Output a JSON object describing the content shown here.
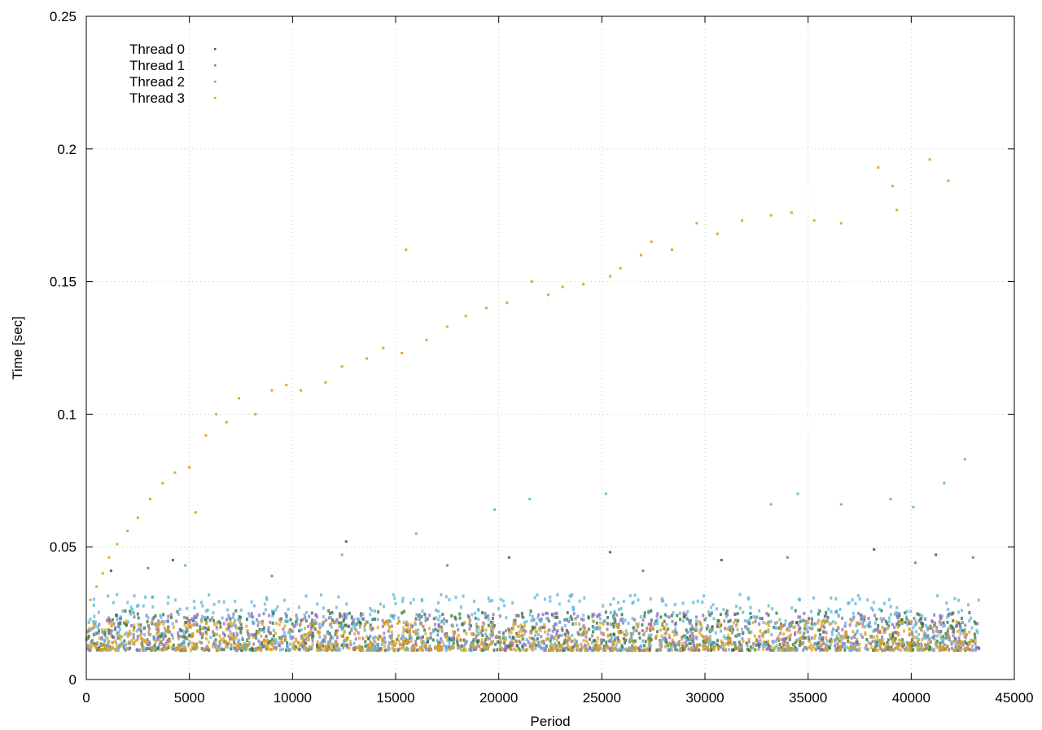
{
  "chart_data": {
    "type": "scatter",
    "title": "",
    "xlabel": "Period",
    "ylabel": "Time [sec]",
    "xlim": [
      0,
      45000
    ],
    "ylim": [
      0,
      0.25
    ],
    "x_ticks": [
      0,
      5000,
      10000,
      15000,
      20000,
      25000,
      30000,
      35000,
      40000,
      45000
    ],
    "x_tick_labels": [
      "0",
      "5000",
      "10000",
      "15000",
      "20000",
      "25000",
      "30000",
      "35000",
      "40000",
      "45000"
    ],
    "y_ticks": [
      0,
      0.05,
      0.1,
      0.15,
      0.2,
      0.25
    ],
    "y_tick_labels": [
      "0",
      "0.05",
      "0.1",
      "0.15",
      "0.2",
      "0.25"
    ],
    "grid": true,
    "legend_position": "top-left",
    "series": [
      {
        "name": "Thread 0",
        "color": "#2e6b3a",
        "baseline_band": {
          "x_range": [
            0,
            43300
          ],
          "y_range": [
            0.011,
            0.026
          ]
        },
        "outliers": [
          [
            1200,
            0.041
          ],
          [
            12600,
            0.052
          ],
          [
            20500,
            0.046
          ],
          [
            25400,
            0.048
          ],
          [
            30800,
            0.045
          ],
          [
            38200,
            0.049
          ],
          [
            41200,
            0.047
          ],
          [
            4200,
            0.045
          ]
        ]
      },
      {
        "name": "Thread 1",
        "color": "#8c6bb1",
        "baseline_band": {
          "x_range": [
            0,
            43300
          ],
          "y_range": [
            0.011,
            0.025
          ]
        },
        "outliers": [
          [
            3000,
            0.042
          ],
          [
            9000,
            0.039
          ],
          [
            17500,
            0.043
          ],
          [
            27000,
            0.041
          ],
          [
            34000,
            0.046
          ],
          [
            40200,
            0.044
          ],
          [
            43000,
            0.046
          ]
        ]
      },
      {
        "name": "Thread 2",
        "color": "#5ab4d8",
        "baseline_band": {
          "x_range": [
            0,
            43300
          ],
          "y_range": [
            0.011,
            0.032
          ]
        },
        "outliers": [
          [
            4800,
            0.043
          ],
          [
            12400,
            0.047
          ],
          [
            16000,
            0.055
          ],
          [
            19800,
            0.064
          ],
          [
            21500,
            0.068
          ],
          [
            25200,
            0.07
          ],
          [
            34500,
            0.07
          ],
          [
            39000,
            0.068
          ],
          [
            41600,
            0.074
          ],
          [
            42600,
            0.083
          ],
          [
            33200,
            0.066
          ],
          [
            36600,
            0.066
          ],
          [
            40100,
            0.065
          ]
        ]
      },
      {
        "name": "Thread 3",
        "color": "#dca11e",
        "baseline_band": {
          "x_range": [
            0,
            43300
          ],
          "y_range": [
            0.011,
            0.022
          ]
        },
        "outliers": [
          [
            200,
            0.03
          ],
          [
            500,
            0.035
          ],
          [
            800,
            0.04
          ],
          [
            1100,
            0.046
          ],
          [
            1500,
            0.051
          ],
          [
            2000,
            0.056
          ],
          [
            2500,
            0.061
          ],
          [
            3100,
            0.068
          ],
          [
            3700,
            0.074
          ],
          [
            4300,
            0.078
          ],
          [
            5000,
            0.08
          ],
          [
            5300,
            0.063
          ],
          [
            5800,
            0.092
          ],
          [
            6300,
            0.1
          ],
          [
            6800,
            0.097
          ],
          [
            7400,
            0.106
          ],
          [
            8200,
            0.1
          ],
          [
            9000,
            0.109
          ],
          [
            9700,
            0.111
          ],
          [
            10400,
            0.109
          ],
          [
            11600,
            0.112
          ],
          [
            12400,
            0.118
          ],
          [
            13600,
            0.121
          ],
          [
            14400,
            0.125
          ],
          [
            15300,
            0.123
          ],
          [
            15500,
            0.162
          ],
          [
            16500,
            0.128
          ],
          [
            17500,
            0.133
          ],
          [
            18400,
            0.137
          ],
          [
            19400,
            0.14
          ],
          [
            20400,
            0.142
          ],
          [
            21600,
            0.15
          ],
          [
            22400,
            0.145
          ],
          [
            23100,
            0.148
          ],
          [
            24100,
            0.149
          ],
          [
            25400,
            0.152
          ],
          [
            25900,
            0.155
          ],
          [
            26900,
            0.16
          ],
          [
            27400,
            0.165
          ],
          [
            28400,
            0.162
          ],
          [
            29600,
            0.172
          ],
          [
            30600,
            0.168
          ],
          [
            31800,
            0.173
          ],
          [
            33200,
            0.175
          ],
          [
            34200,
            0.176
          ],
          [
            35300,
            0.173
          ],
          [
            36600,
            0.172
          ],
          [
            38400,
            0.193
          ],
          [
            39100,
            0.186
          ],
          [
            39300,
            0.177
          ],
          [
            40900,
            0.196
          ],
          [
            41800,
            0.188
          ]
        ]
      }
    ]
  }
}
